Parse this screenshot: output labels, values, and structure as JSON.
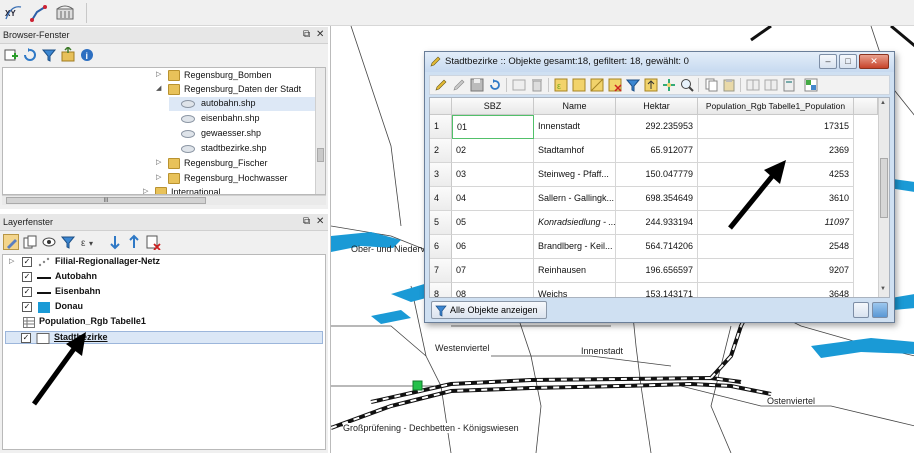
{
  "browser_panel": {
    "title": "Browser-Fenster",
    "items": [
      {
        "label": "Regensburg_Bomben",
        "icon": "folder-icon",
        "expanded": false
      },
      {
        "label": "Regensburg_Daten der Stadt",
        "icon": "folder-icon",
        "expanded": true
      },
      {
        "label": "autobahn.shp",
        "icon": "shapefile-icon",
        "selected": true
      },
      {
        "label": "eisenbahn.shp",
        "icon": "shapefile-icon"
      },
      {
        "label": "gewaesser.shp",
        "icon": "shapefile-icon"
      },
      {
        "label": "stadtbezirke.shp",
        "icon": "shapefile-icon"
      },
      {
        "label": "Regensburg_Fischer",
        "icon": "folder-icon",
        "expanded": false
      },
      {
        "label": "Regensburg_Hochwasser",
        "icon": "folder-icon",
        "expanded": false
      },
      {
        "label": "International",
        "icon": "folder-icon",
        "expanded": false
      }
    ]
  },
  "layer_panel": {
    "title": "Layerfenster",
    "layers": [
      {
        "label": "Filial-Regionallager-Netz",
        "checked": true,
        "symbol": "point-group-icon"
      },
      {
        "label": "Autobahn",
        "checked": true,
        "symbol": "line-symbol-icon"
      },
      {
        "label": "Eisenbahn",
        "checked": true,
        "symbol": "line-symbol-icon"
      },
      {
        "label": "Donau",
        "checked": true,
        "symbol": "polygon-blue-icon"
      },
      {
        "label": "Population_Rgb Tabelle1",
        "checked": false,
        "symbol": "table-icon"
      },
      {
        "label": "Stadtbezirke",
        "checked": true,
        "symbol": "polygon-white-icon",
        "selected": true
      }
    ]
  },
  "map": {
    "labels": {
      "ober_nieder": "Ober- und Niederv",
      "westenviertel": "Westenviertel",
      "innenstadt": "Innenstadt",
      "ostenviertel": "Ostenviertel",
      "grosspruefening": "Großprüfening - Dechbetten - Königswiesen"
    },
    "colors": {
      "river": "#1a9ad6",
      "rail": "#111111",
      "highlight": "#24c04a"
    }
  },
  "attribute_window": {
    "title": "Stadtbezirke :: Objekte gesamt:18, gefiltert: 18, gewählt: 0",
    "columns": [
      "SBZ",
      "Name",
      "Hektar",
      "Population_Rgb Tabelle1_Population"
    ],
    "rows": [
      {
        "n": "1",
        "sbz": "01",
        "name": "Innenstadt",
        "hektar": "292.235953",
        "pop": "17315"
      },
      {
        "n": "2",
        "sbz": "02",
        "name": "Stadtamhof",
        "hektar": "65.912077",
        "pop": "2369"
      },
      {
        "n": "3",
        "sbz": "03",
        "name": "Steinweg - Pfaff...",
        "hektar": "150.047779",
        "pop": "4253"
      },
      {
        "n": "4",
        "sbz": "04",
        "name": "Sallern - Gallingk...",
        "hektar": "698.354649",
        "pop": "3610"
      },
      {
        "n": "5",
        "sbz": "05",
        "name": "Konradsiedlung - ...",
        "hektar": "244.933194",
        "pop": "11097"
      },
      {
        "n": "6",
        "sbz": "06",
        "name": "Brandlberg - Keil...",
        "hektar": "564.714206",
        "pop": "2548"
      },
      {
        "n": "7",
        "sbz": "07",
        "name": "Reinhausen",
        "hektar": "196.656597",
        "pop": "9207"
      },
      {
        "n": "8",
        "sbz": "08",
        "name": "Weichs",
        "hektar": "153.143171",
        "pop": "3648"
      }
    ],
    "show_all_button": "Alle Objekte anzeigen"
  },
  "scroll_glyph": "III"
}
